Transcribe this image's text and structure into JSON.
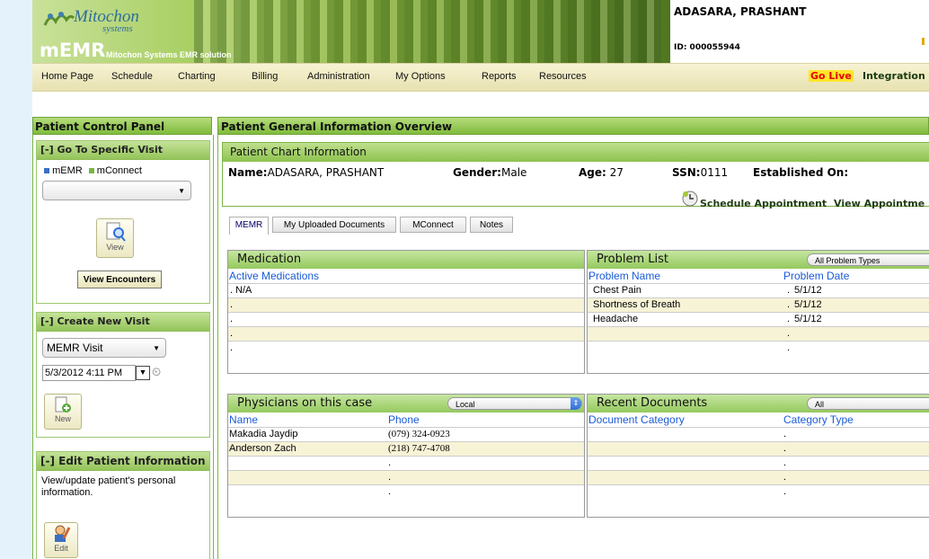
{
  "header": {
    "logo_name": "Mitochon",
    "logo_sub": "systems",
    "product": "mEMR",
    "product_sub": "Mitochon Systems EMR solution",
    "patient_name": "ADASARA, PRASHANT",
    "patient_id": "ID: 000055944"
  },
  "nav": {
    "items": [
      "Home Page",
      "Schedule",
      "Charting",
      "Billing",
      "Administration",
      "My Options",
      "Reports",
      "Resources"
    ],
    "go_live": "Go Live",
    "integration": "Integration"
  },
  "left_panel": {
    "title": "Patient Control Panel",
    "go_to_visit": {
      "title": "[-] Go To Specific Visit",
      "legend_memr": "mEMR",
      "legend_mconnect": "mConnect",
      "select_value": "",
      "view_label": "View",
      "view_encounters": "View Encounters"
    },
    "create_visit": {
      "title": "[-] Create New Visit",
      "visit_type": "MEMR Visit",
      "datetime": "5/3/2012 4:11 PM",
      "new_label": "New"
    },
    "edit_patient": {
      "title": "[-] Edit Patient Information",
      "description": "View/update patient's personal information.",
      "edit_label": "Edit"
    }
  },
  "main": {
    "title": "Patient General Information Overview",
    "chart_info": {
      "title": "Patient Chart Information",
      "name_label": "Name:",
      "name_value": "ADASARA, PRASHANT",
      "gender_label": "Gender:",
      "gender_value": "Male",
      "age_label": "Age:",
      "age_value": "27",
      "ssn_label": "SSN:",
      "ssn_value": "0111",
      "established_label": "Established On:"
    },
    "schedule_link": "Schedule Appointment",
    "view_link": "View Appointme",
    "tabs": [
      "MEMR",
      "My Uploaded Documents",
      "MConnect",
      "Notes"
    ],
    "medication": {
      "title": "Medication",
      "col": "Active Medications",
      "rows": [
        "N/A",
        "",
        "",
        "",
        ""
      ]
    },
    "problem_list": {
      "title": "Problem List",
      "filter": "All Problem Types",
      "col_name": "Problem Name",
      "col_date": "Problem Date",
      "rows": [
        {
          "name": "Chest Pain",
          "date": "5/1/12"
        },
        {
          "name": "Shortness of Breath",
          "date": "5/1/12"
        },
        {
          "name": "Headache",
          "date": "5/1/12"
        },
        {
          "name": "",
          "date": ""
        },
        {
          "name": "",
          "date": ""
        }
      ]
    },
    "physicians": {
      "title": "Physicians on this case",
      "filter": "Local",
      "col_name": "Name",
      "col_phone": "Phone",
      "rows": [
        {
          "name": "Makadia Jaydip",
          "phone": "(079) 324-0923"
        },
        {
          "name": "Anderson Zach",
          "phone": "(218) 747-4708"
        },
        {
          "name": "",
          "phone": ""
        },
        {
          "name": "",
          "phone": ""
        },
        {
          "name": "",
          "phone": ""
        }
      ]
    },
    "documents": {
      "title": "Recent Documents",
      "filter": "All",
      "col_category": "Document Category",
      "col_type": "Category Type",
      "rows": [
        {
          "category": "",
          "type": ""
        },
        {
          "category": "",
          "type": ""
        },
        {
          "category": "",
          "type": ""
        },
        {
          "category": "",
          "type": ""
        },
        {
          "category": "",
          "type": ""
        }
      ]
    }
  }
}
